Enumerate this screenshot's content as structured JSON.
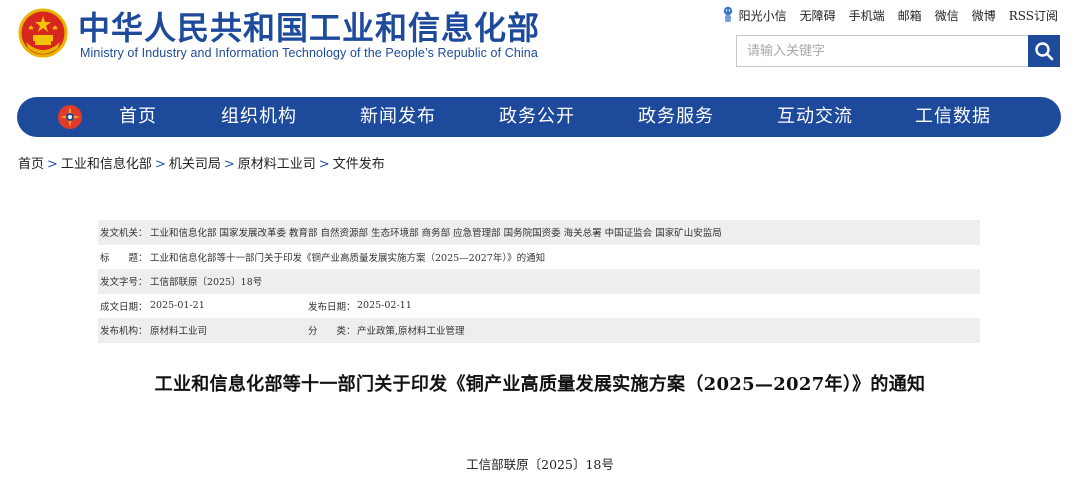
{
  "header": {
    "title": "中华人民共和国工业和信息化部",
    "subtitle": "Ministry of Industry and Information Technology of the People’s Republic of China",
    "top_links": [
      "阳光小信",
      "无障碍",
      "手机端",
      "邮箱",
      "微信",
      "微博",
      "RSS订阅"
    ],
    "search_placeholder": "请输入关键字"
  },
  "nav": {
    "items": [
      "首页",
      "组织机构",
      "新闻发布",
      "政务公开",
      "政务服务",
      "互动交流",
      "工信数据"
    ]
  },
  "breadcrumb": [
    "首页",
    "工业和信息化部",
    "机关司局",
    "原材料工业司",
    "文件发布"
  ],
  "info": {
    "issuer_label": "发文机关：",
    "issuer_value": "工业和信息化部 国家发展改革委 教育部 自然资源部 生态环境部 商务部 应急管理部 国务院国资委 海关总署 中国证监会 国家矿山安监局",
    "title_label": "标　　题：",
    "title_value": "工业和信息化部等十一部门关于印发《铜产业高质量发展实施方案（2025—2027年）》的通知",
    "docno_label": "发文字号：",
    "docno_value": "工信部联原〔2025〕18号",
    "written_label": "成文日期：",
    "written_value": "2025-01-21",
    "published_label": "发布日期：",
    "published_value": "2025-02-11",
    "org_label": "发布机构：",
    "org_value": "原材料工业司",
    "category_label": "分　　类：",
    "category_value": "产业政策,原材料工业管理"
  },
  "article": {
    "title": "工业和信息化部等十一部门关于印发《铜产业高质量发展实施方案（2025—2027年）》的通知",
    "doc_number": "工信部联原〔2025〕18号"
  },
  "colors": {
    "brand_blue": "#1e4a9c",
    "row_shade": "#eeeeee"
  }
}
